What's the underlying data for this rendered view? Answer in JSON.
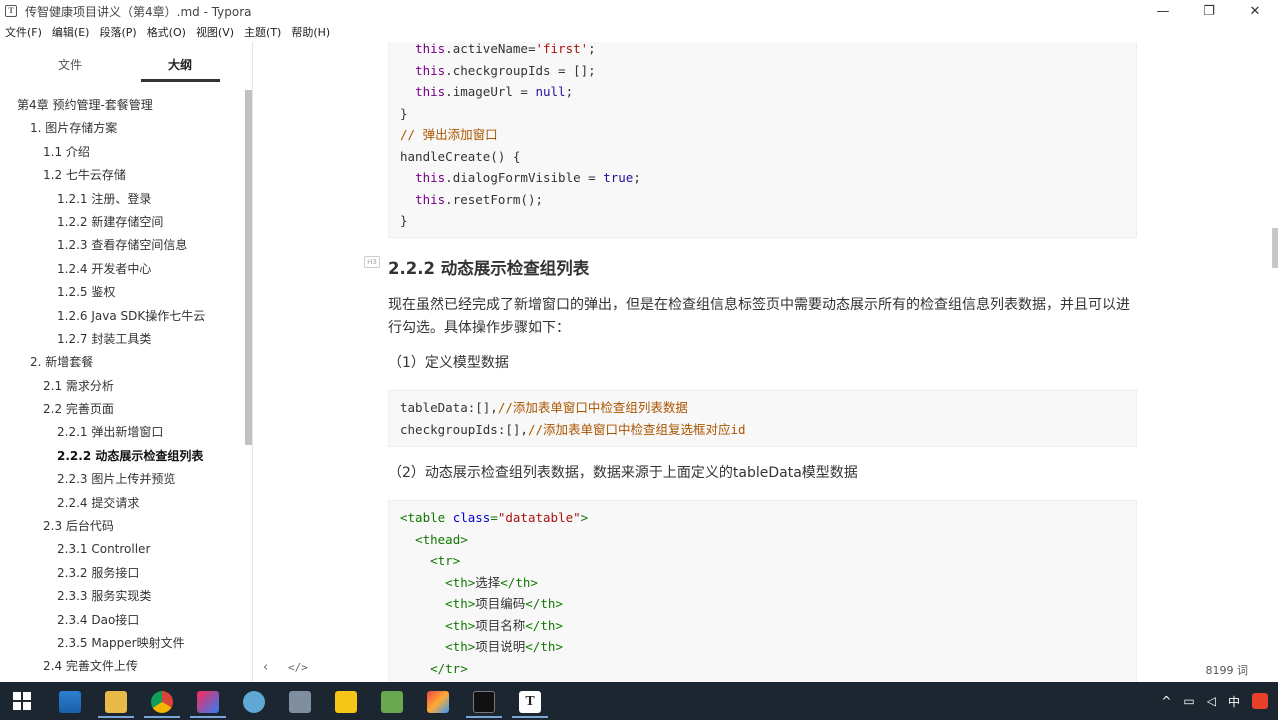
{
  "window": {
    "title": "传智健康项目讲义（第4章）.md - Typora",
    "app_icon": "T",
    "minimize": "—",
    "restore": "❐",
    "close": "✕"
  },
  "menu": [
    "文件(F)",
    "编辑(E)",
    "段落(P)",
    "格式(O)",
    "视图(V)",
    "主题(T)",
    "帮助(H)"
  ],
  "sidebar": {
    "tab_files": "文件",
    "tab_outline": "大纲",
    "outline": [
      {
        "label": "第4章 预约管理-套餐管理",
        "level": 1
      },
      {
        "label": "1. 图片存储方案",
        "level": 2
      },
      {
        "label": "1.1 介绍",
        "level": 3
      },
      {
        "label": "1.2 七牛云存储",
        "level": 3
      },
      {
        "label": "1.2.1 注册、登录",
        "level": 4
      },
      {
        "label": "1.2.2 新建存储空间",
        "level": 4
      },
      {
        "label": "1.2.3 查看存储空间信息",
        "level": 4
      },
      {
        "label": "1.2.4 开发者中心",
        "level": 4
      },
      {
        "label": "1.2.5 鉴权",
        "level": 4
      },
      {
        "label": "1.2.6 Java SDK操作七牛云",
        "level": 4
      },
      {
        "label": "1.2.7 封装工具类",
        "level": 4
      },
      {
        "label": "2. 新增套餐",
        "level": 2
      },
      {
        "label": "2.1 需求分析",
        "level": 3
      },
      {
        "label": "2.2 完善页面",
        "level": 3
      },
      {
        "label": "2.2.1 弹出新增窗口",
        "level": 4
      },
      {
        "label": "2.2.2 动态展示检查组列表",
        "level": 4,
        "active": true
      },
      {
        "label": "2.2.3 图片上传并预览",
        "level": 4
      },
      {
        "label": "2.2.4 提交请求",
        "level": 4
      },
      {
        "label": "2.3 后台代码",
        "level": 3
      },
      {
        "label": "2.3.1 Controller",
        "level": 4
      },
      {
        "label": "2.3.2 服务接口",
        "level": 4
      },
      {
        "label": "2.3.3 服务实现类",
        "level": 4
      },
      {
        "label": "2.3.4 Dao接口",
        "level": 4
      },
      {
        "label": "2.3.5 Mapper映射文件",
        "level": 4
      },
      {
        "label": "2.4 完善文件上传",
        "level": 3
      }
    ]
  },
  "content": {
    "code1": [
      [
        {
          "t": "  "
        },
        {
          "t": "this",
          "c": "kw"
        },
        {
          "t": ".activeName="
        },
        {
          "t": "'first'",
          "c": "str"
        },
        {
          "t": ";"
        }
      ],
      [
        {
          "t": "  "
        },
        {
          "t": "this",
          "c": "kw"
        },
        {
          "t": ".checkgroupIds = [];"
        }
      ],
      [
        {
          "t": "  "
        },
        {
          "t": "this",
          "c": "kw"
        },
        {
          "t": ".imageUrl = "
        },
        {
          "t": "null",
          "c": "num"
        },
        {
          "t": ";"
        }
      ],
      [
        {
          "t": "}"
        }
      ],
      [
        {
          "t": "// 弹出添加窗口",
          "c": "cmt"
        }
      ],
      [
        {
          "t": "handleCreate() {"
        }
      ],
      [
        {
          "t": "  "
        },
        {
          "t": "this",
          "c": "kw"
        },
        {
          "t": ".dialogFormVisible = "
        },
        {
          "t": "true",
          "c": "num"
        },
        {
          "t": ";"
        }
      ],
      [
        {
          "t": "  "
        },
        {
          "t": "this",
          "c": "kw"
        },
        {
          "t": ".resetForm();"
        }
      ],
      [
        {
          "t": "}"
        }
      ]
    ],
    "heading": "2.2.2 动态展示检查组列表",
    "heading_marker": "H3",
    "para1": "现在虽然已经完成了新增窗口的弹出，但是在检查组信息标签页中需要动态展示所有的检查组信息列表数据，并且可以进行勾选。具体操作步骤如下：",
    "step1": "（1）定义模型数据",
    "code2": [
      [
        {
          "t": "tableData:[],"
        },
        {
          "t": "//添加表单窗口中检查组列表数据",
          "c": "cmt"
        }
      ],
      [
        {
          "t": "checkgroupIds:[],"
        },
        {
          "t": "//添加表单窗口中检查组复选框对应id",
          "c": "cmt"
        }
      ]
    ],
    "step2": "（2）动态展示检查组列表数据，数据来源于上面定义的tableData模型数据",
    "code3": [
      [
        {
          "t": "<table ",
          "c": "tag"
        },
        {
          "t": "class",
          "c": "attr"
        },
        {
          "t": "=",
          "c": "tag"
        },
        {
          "t": "\"datatable\"",
          "c": "str"
        },
        {
          "t": ">",
          "c": "tag"
        }
      ],
      [
        {
          "t": "  "
        },
        {
          "t": "<thead>",
          "c": "tag"
        }
      ],
      [
        {
          "t": "    "
        },
        {
          "t": "<tr>",
          "c": "tag"
        }
      ],
      [
        {
          "t": "      "
        },
        {
          "t": "<th>",
          "c": "tag"
        },
        {
          "t": "选择"
        },
        {
          "t": "</th>",
          "c": "tag"
        }
      ],
      [
        {
          "t": "      "
        },
        {
          "t": "<th>",
          "c": "tag"
        },
        {
          "t": "项目编码"
        },
        {
          "t": "</th>",
          "c": "tag"
        }
      ],
      [
        {
          "t": "      "
        },
        {
          "t": "<th>",
          "c": "tag"
        },
        {
          "t": "项目名称"
        },
        {
          "t": "</th>",
          "c": "tag"
        }
      ],
      [
        {
          "t": "      "
        },
        {
          "t": "<th>",
          "c": "tag"
        },
        {
          "t": "项目说明"
        },
        {
          "t": "</th>",
          "c": "tag"
        }
      ],
      [
        {
          "t": "    "
        },
        {
          "t": "</tr>",
          "c": "tag"
        }
      ]
    ]
  },
  "statusbar": {
    "back": "‹",
    "source_toggle": "</>",
    "word_count": "8199 词"
  },
  "taskbar": {
    "tray_ime": "中",
    "tray_up": "^",
    "apps": [
      "explorer",
      "folder",
      "chrome",
      "intellij",
      "browser",
      "app",
      "weibo",
      "notepad",
      "app2",
      "terminal",
      "typora"
    ]
  }
}
